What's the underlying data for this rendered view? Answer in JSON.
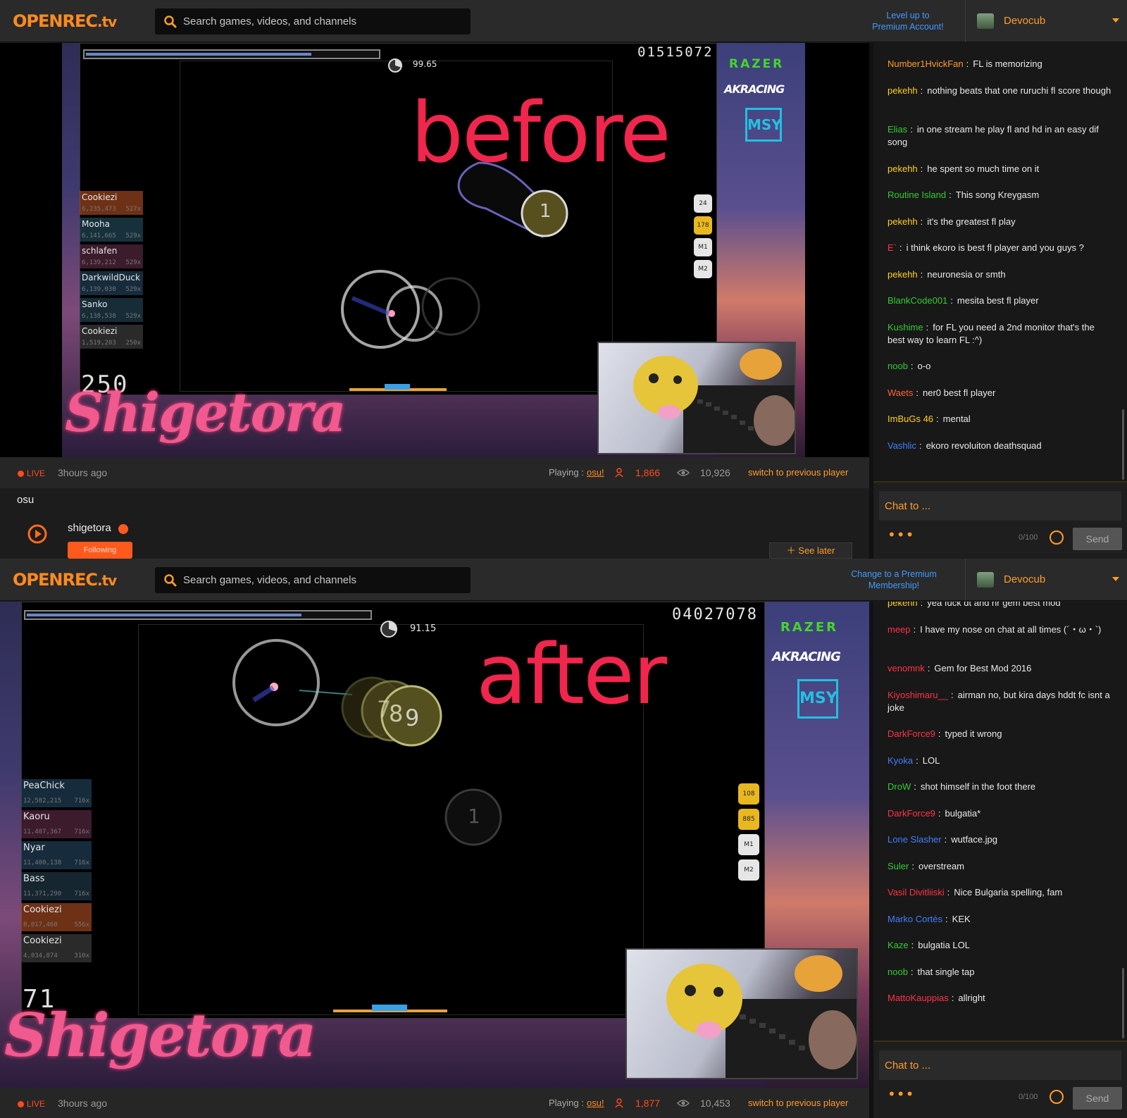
{
  "before": {
    "header": {
      "logo": "OPENREC",
      "logo_suffix": ".tv",
      "search_placeholder": "Search games, videos, and channels",
      "premium_line1": "Level up to",
      "premium_line2": "Premium Account!",
      "username": "Devocub"
    },
    "game": {
      "overlay_word": "before",
      "score": "01515072",
      "accuracy": "99.65",
      "combo": "250",
      "streamer": "Shigetora",
      "hit_circle_number": "1",
      "keys": [
        "24",
        "178",
        "M1",
        "M2"
      ],
      "leaderboard": [
        {
          "name": "Cookiezi",
          "score": "6,235,473",
          "combo": "527x"
        },
        {
          "name": "Mooha",
          "score": "6,141,665",
          "combo": "529x"
        },
        {
          "name": "schlafen",
          "score": "6,139,212",
          "combo": "529x"
        },
        {
          "name": "DarkwildDuck",
          "score": "6,139,030",
          "combo": "529x"
        },
        {
          "name": "Sanko",
          "score": "6,138,538",
          "combo": "529x"
        },
        {
          "name": "Cookiezi",
          "score": "1,519,203",
          "combo": "250x"
        }
      ],
      "sponsors": {
        "razer": "RAZER",
        "akracing": "AKRACING",
        "msy": "MSY"
      }
    },
    "infobar": {
      "live": "LIVE",
      "time_ago": "3hours ago",
      "playing_label": "Playing :",
      "game": "osu!",
      "followers": "1,866",
      "viewers": "10,926",
      "switch": "switch to previous player"
    },
    "description": {
      "title": "osu",
      "channel": "shigetora",
      "follow": "Following",
      "see_later": "See later"
    },
    "chat": {
      "messages": [
        {
          "user": "Number1HvickFan",
          "color": "#ff9c2a",
          "text": "FL is memorizing"
        },
        {
          "user": "pekehh",
          "color": "#ffd21e",
          "text": "nothing beats that one ruruchi fl score though"
        },
        {
          "user": "Elias",
          "color": "#33cc33",
          "text": "in one stream he play fl and hd in an easy dif song"
        },
        {
          "user": "pekehh",
          "color": "#ffd21e",
          "text": "he spent so much time on it"
        },
        {
          "user": "Routine Island",
          "color": "#33cc33",
          "text": "This song Kreygasm"
        },
        {
          "user": "pekehh",
          "color": "#ffd21e",
          "text": "it's the greatest fl play"
        },
        {
          "user": "E`",
          "color": "#ff3344",
          "text": "i think ekoro is best fl player and you guys ?"
        },
        {
          "user": "pekehh",
          "color": "#ffd21e",
          "text": "neuronesia or smth"
        },
        {
          "user": "BlankCode001",
          "color": "#33cc33",
          "text": "mesita best fl player"
        },
        {
          "user": "Kushime",
          "color": "#33cc33",
          "text": "for FL you need a 2nd monitor that's the best way to learn FL :^)"
        },
        {
          "user": "noob",
          "color": "#33cc33",
          "text": "o-o"
        },
        {
          "user": "Waets",
          "color": "#ff6633",
          "text": "ner0 best fl player"
        },
        {
          "user": "ImBuGs 46",
          "color": "#ffd21e",
          "text": "mental"
        },
        {
          "user": "Vashlic",
          "color": "#3f7fff",
          "text": "ekoro revoluiton deathsquad"
        }
      ],
      "input_placeholder": "Chat to ...",
      "more": "•••",
      "char_count": "0/100",
      "send": "Send"
    }
  },
  "after": {
    "header": {
      "logo": "OPENREC",
      "logo_suffix": ".tv",
      "search_placeholder": "Search games, videos, and channels",
      "premium_line1": "Change to a Premium",
      "premium_line2": "Membership!",
      "username": "Devocub"
    },
    "game": {
      "overlay_word": "after",
      "score": "04027078",
      "accuracy": "91.15",
      "combo": "71",
      "streamer": "Shigetora",
      "hit_circle_numbers": [
        "7",
        "8",
        "9",
        "1"
      ],
      "keys": [
        "108",
        "885",
        "M1",
        "M2"
      ],
      "leaderboard": [
        {
          "name": "PeaChick",
          "score": "12,582,215",
          "combo": "716x"
        },
        {
          "name": "Kaoru",
          "score": "11,407,367",
          "combo": "716x"
        },
        {
          "name": "Nyar",
          "score": "11,400,138",
          "combo": "716x"
        },
        {
          "name": "Bass",
          "score": "11,371,290",
          "combo": "716x"
        },
        {
          "name": "Cookiezi",
          "score": "8,017,460",
          "combo": "556x"
        },
        {
          "name": "Cookiezi",
          "score": "4,034,074",
          "combo": "310x"
        }
      ],
      "sponsors": {
        "razer": "RAZER",
        "akracing": "AKRACING",
        "msy": "MSY"
      }
    },
    "infobar": {
      "live": "LIVE",
      "time_ago": "3hours ago",
      "playing_label": "Playing :",
      "game": "osu!",
      "followers": "1,877",
      "viewers": "10,453",
      "switch": "switch to previous player"
    },
    "chat": {
      "messages": [
        {
          "user": "pekehh",
          "color": "#ffd21e",
          "text": "yea fuck dt and hr gem best mod"
        },
        {
          "user": "meep",
          "color": "#ff3344",
          "text": "I have my nose on chat at all times (´・ω・`)"
        },
        {
          "user": "venomnk",
          "color": "#ff3344",
          "text": "Gem for Best Mod 2016"
        },
        {
          "user": "Kiyoshimaru__",
          "color": "#ff3344",
          "text": "airman no, but kira days hddt fc isnt a joke"
        },
        {
          "user": "DarkForce9",
          "color": "#ff3344",
          "text": "typed it wrong"
        },
        {
          "user": "Kyoka",
          "color": "#3f7fff",
          "text": "LOL"
        },
        {
          "user": "DroW",
          "color": "#33cc33",
          "text": "shot himself in the foot there"
        },
        {
          "user": "DarkForce9",
          "color": "#ff3344",
          "text": "bulgatia*"
        },
        {
          "user": "Lone Slasher",
          "color": "#3f7fff",
          "text": "wutface.jpg"
        },
        {
          "user": "Suler",
          "color": "#33cc33",
          "text": "overstream"
        },
        {
          "user": "Vasil Divitliiski",
          "color": "#ff3344",
          "text": "Nice Bulgaria spelling, fam"
        },
        {
          "user": "Marko Cortés",
          "color": "#3f7fff",
          "text": "KEK"
        },
        {
          "user": "Kaze",
          "color": "#33cc33",
          "text": "bulgatia LOL"
        },
        {
          "user": "noob",
          "color": "#33cc33",
          "text": "that single tap"
        },
        {
          "user": "MattoKauppias",
          "color": "#ff3344",
          "text": "allright"
        }
      ],
      "input_placeholder": "Chat to ...",
      "more": "•••",
      "char_count": "0/100",
      "send": "Send"
    }
  }
}
